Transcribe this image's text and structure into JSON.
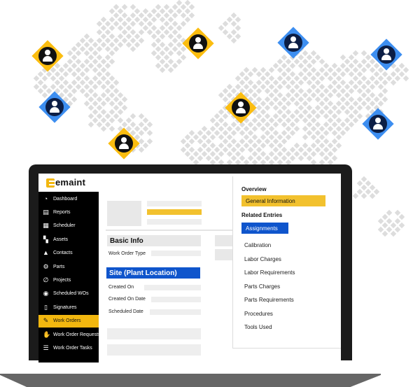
{
  "brand": {
    "name": "emaint",
    "accent_yellow": "#f2b70f",
    "accent_blue": "#0f55cc"
  },
  "map": {
    "marker_colors": {
      "yellow": "#fbbd10",
      "blue": "#3d8ef0"
    },
    "markers": [
      {
        "color": "yellow",
        "icon": "user-icon"
      },
      {
        "color": "blue",
        "icon": "user-icon"
      },
      {
        "color": "yellow",
        "icon": "user-icon"
      },
      {
        "color": "yellow",
        "icon": "user-icon"
      },
      {
        "color": "yellow",
        "icon": "user-icon"
      },
      {
        "color": "blue",
        "icon": "user-icon"
      },
      {
        "color": "blue",
        "icon": "user-icon"
      },
      {
        "color": "blue",
        "icon": "user-icon"
      }
    ]
  },
  "sidebar": {
    "items": [
      {
        "label": "Dashboard",
        "icon": "pie-chart-icon",
        "active": false
      },
      {
        "label": "Reports",
        "icon": "document-icon",
        "active": false
      },
      {
        "label": "Scheduler",
        "icon": "calendar-icon",
        "active": false
      },
      {
        "label": "Assets",
        "icon": "grid-icon",
        "active": false
      },
      {
        "label": "Contacts",
        "icon": "person-icon",
        "active": false
      },
      {
        "label": "Parts",
        "icon": "gears-icon",
        "active": false
      },
      {
        "label": "Projects",
        "icon": "paperclip-icon",
        "active": false
      },
      {
        "label": "Scheduled WOs",
        "icon": "target-icon",
        "active": false
      },
      {
        "label": "Signatures",
        "icon": "page-icon",
        "active": false
      },
      {
        "label": "Work Orders",
        "icon": "wrench-icon",
        "active": true
      },
      {
        "label": "Work Order Requests",
        "icon": "hand-icon",
        "active": false
      },
      {
        "label": "Work Order Tasks",
        "icon": "list-icon",
        "active": false
      }
    ]
  },
  "main": {
    "basic_info": "Basic Info",
    "work_order_type": "Work Order Type",
    "site": "Site (Plant Location)",
    "created_on": "Created On",
    "created_on_date": "Created On Date",
    "scheduled_date": "Scheduled Date"
  },
  "right_panel": {
    "overview_heading": "Overview",
    "general_information": "General Information",
    "related_heading": "Related Entries",
    "assignments": "Assignments",
    "items": [
      "Calibration",
      "Labor Charges",
      "Labor Requirements",
      "Parts Charges",
      "Parts Requirements",
      "Procedures",
      "Tools Used"
    ]
  }
}
